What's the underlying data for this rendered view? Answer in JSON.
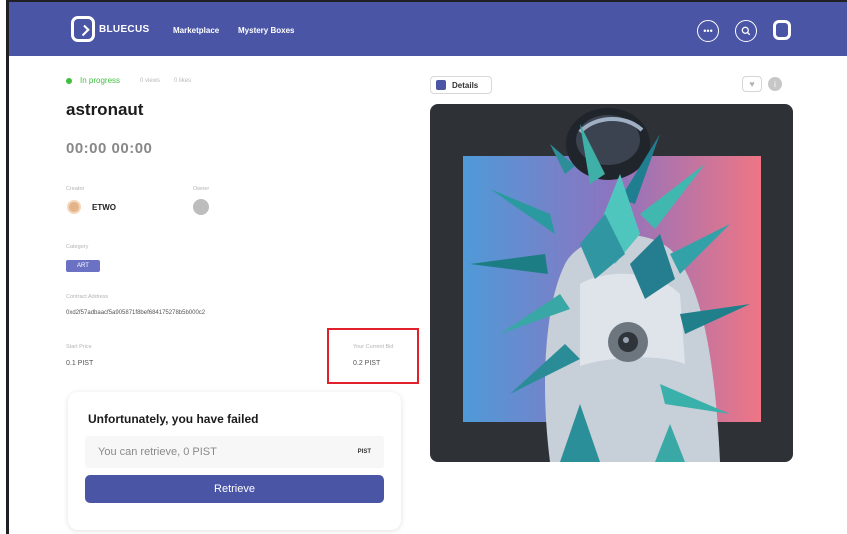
{
  "header": {
    "brand": "BLUECUS",
    "nav": [
      "Marketplace",
      "Mystery Boxes"
    ],
    "more_icon": "more-icon",
    "search_icon": "search-icon",
    "color": "#4a55a6"
  },
  "item": {
    "status": "In progress",
    "views": "0 views",
    "likes": "0 likes",
    "title": "astronaut",
    "timer": "00:00 00:00",
    "creator_label": "Creator",
    "creator_name": "ETWO",
    "owner_label": "Owner",
    "category_label": "Category",
    "category": "ART",
    "contract_label": "Contract Address",
    "contract": "0xd2f57adbaacf5a905871f8bef684175278b5b000c2",
    "start_price_label": "Start Price",
    "start_price": "0.1 PIST",
    "current_bid_label": "Your Current Bid",
    "current_bid": "0.2 PIST"
  },
  "result": {
    "title": "Unfortunately, you have failed",
    "retrieve_text": "You can retrieve, 0 PIST",
    "unit": "PIST",
    "button": "Retrieve"
  },
  "artwork_panel": {
    "details": "Details",
    "heart_icon": "heart-icon",
    "info_icon": "info-icon"
  }
}
